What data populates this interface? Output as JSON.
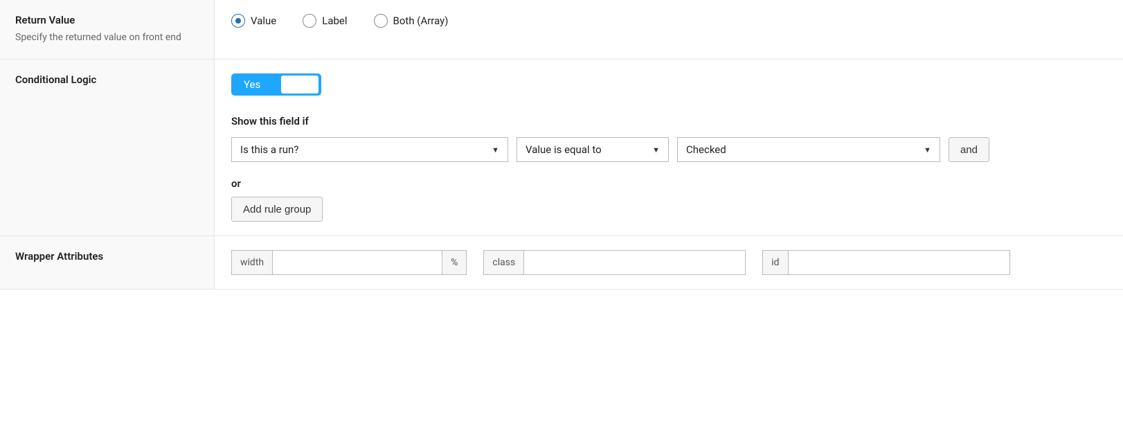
{
  "return_value": {
    "title": "Return Value",
    "desc": "Specify the returned value on front end",
    "options": [
      {
        "label": "Value",
        "checked": true
      },
      {
        "label": "Label",
        "checked": false
      },
      {
        "label": "Both (Array)",
        "checked": false
      }
    ]
  },
  "conditional_logic": {
    "title": "Conditional Logic",
    "toggle": "Yes",
    "subhead": "Show this field if",
    "rule": {
      "field": "Is this a run?",
      "operator": "Value is equal to",
      "value": "Checked",
      "and": "and"
    },
    "or": "or",
    "add_group": "Add rule group"
  },
  "wrapper": {
    "title": "Wrapper Attributes",
    "width_label": "width",
    "width_suffix": "%",
    "class_label": "class",
    "id_label": "id"
  }
}
